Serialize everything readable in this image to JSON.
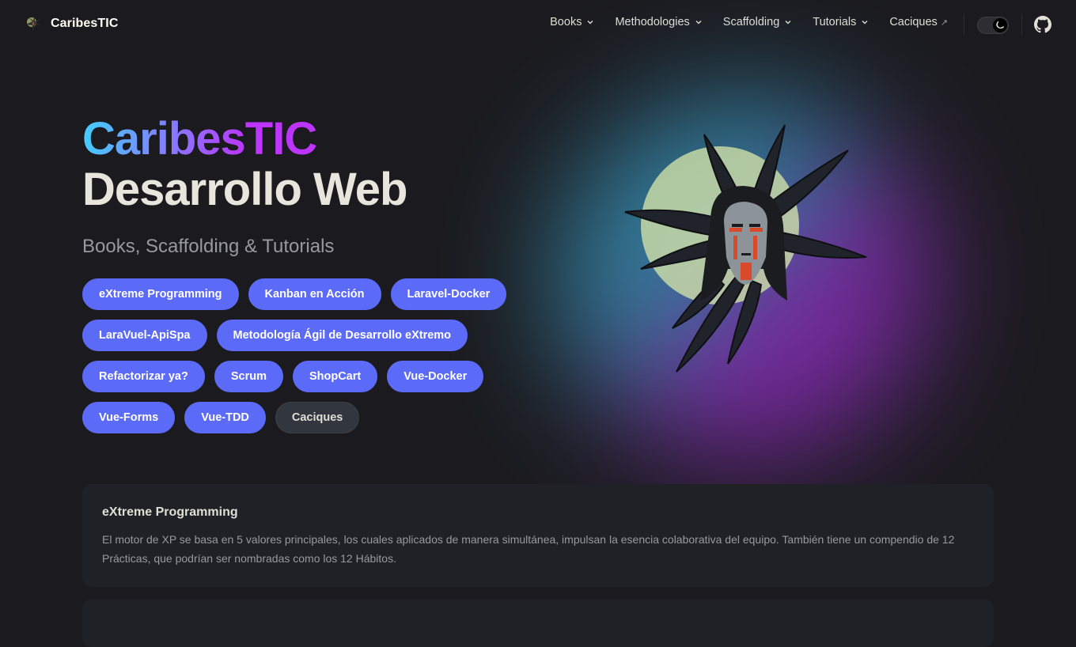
{
  "nav": {
    "title": "CaribesTIC",
    "items": [
      {
        "label": "Books",
        "has_dropdown": true
      },
      {
        "label": "Methodologies",
        "has_dropdown": true
      },
      {
        "label": "Scaffolding",
        "has_dropdown": true
      },
      {
        "label": "Tutorials",
        "has_dropdown": true
      },
      {
        "label": "Caciques",
        "external": true,
        "external_glyph": "↗"
      }
    ],
    "theme": "dark",
    "social_icon": "github-icon"
  },
  "hero": {
    "name": "CaribesTIC",
    "text": "Desarrollo Web",
    "tagline": "Books, Scaffolding & Tutorials",
    "actions": [
      {
        "label": "eXtreme Programming",
        "theme": "brand"
      },
      {
        "label": "Kanban en Acción",
        "theme": "brand"
      },
      {
        "label": "Laravel-Docker",
        "theme": "brand"
      },
      {
        "label": "LaraVuel-ApiSpa",
        "theme": "brand"
      },
      {
        "label": "Metodología Ágil de Desarrollo eXtremo",
        "theme": "brand"
      },
      {
        "label": "Refactorizar ya?",
        "theme": "brand"
      },
      {
        "label": "Scrum",
        "theme": "brand"
      },
      {
        "label": "ShopCart",
        "theme": "brand"
      },
      {
        "label": "Vue-Docker",
        "theme": "brand"
      },
      {
        "label": "Vue-Forms",
        "theme": "brand"
      },
      {
        "label": "Vue-TDD",
        "theme": "brand"
      },
      {
        "label": "Caciques",
        "theme": "alt"
      }
    ],
    "image_icon": "cacique-portrait-icon"
  },
  "features": [
    {
      "title": "eXtreme Programming",
      "details": "El motor de XP se basa en 5 valores principales, los cuales aplicados de manera simultánea, impulsan la esencia colaborativa del equipo. También tiene un compendio de 12 Prácticas, que podrían ser nombradas como los 12 Hábitos."
    }
  ],
  "colors": {
    "background": "#1b1b1f",
    "brand": "#5c6bf7",
    "alt_button": "#32363f",
    "card": "#202127",
    "text": "#dfdfd6",
    "muted": "#98989f",
    "gradient_start": "#41d1ff",
    "gradient_end": "#bd34fe"
  }
}
